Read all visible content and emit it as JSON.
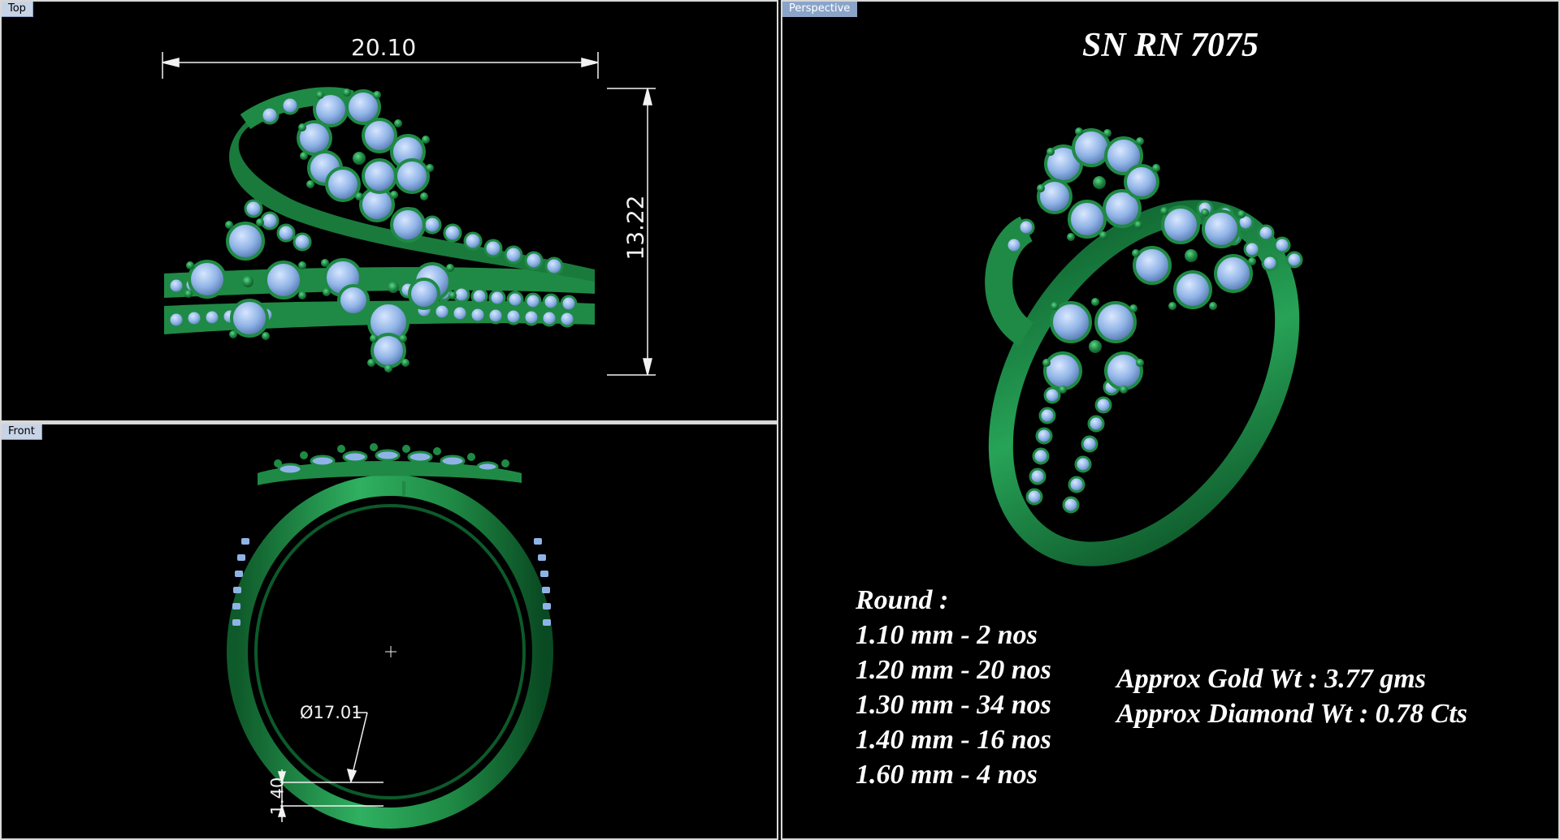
{
  "viewports": {
    "top": {
      "label": "Top",
      "width_dimension": "20.10",
      "height_dimension": "13.22"
    },
    "front": {
      "label": "Front",
      "diameter_dimension": "Ø17.01",
      "thickness_dimension": "1.40"
    },
    "perspective": {
      "label": "Perspective",
      "title": "SN RN 7075",
      "round_heading": "Round :",
      "round_sizes": [
        "1.10 mm - 2 nos",
        "1.20 mm - 20 nos",
        "1.30 mm - 34 nos",
        "1.40 mm - 16 nos",
        "1.60 mm - 4 nos"
      ],
      "gold_weight": "Approx Gold Wt : 3.77 gms",
      "diamond_weight": "Approx Diamond  Wt : 0.78 Cts"
    }
  },
  "colors": {
    "metal": "#1f8a45",
    "metal_dark": "#0f5a2a",
    "stone": "#8fb3e6",
    "dimension": "#f2f2f2"
  }
}
